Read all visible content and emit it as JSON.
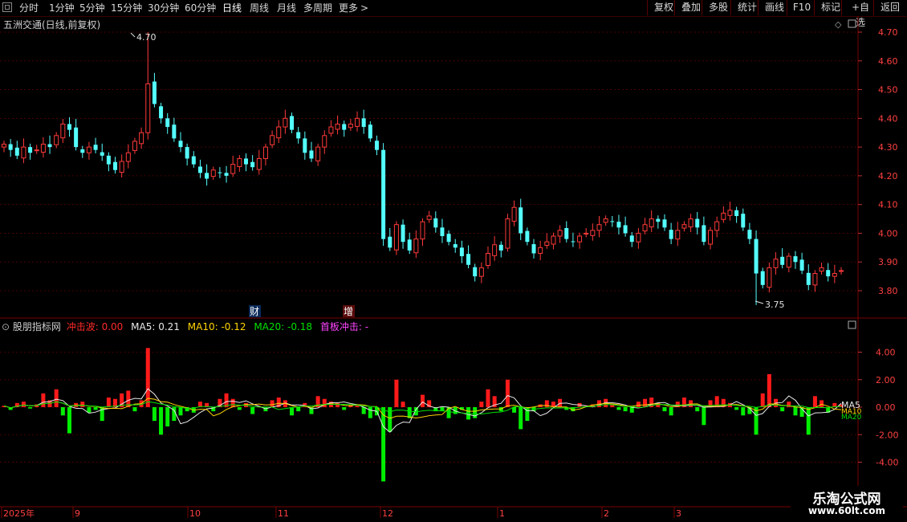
{
  "toolbar": {
    "periods": [
      "分时",
      "1分钟",
      "5分钟",
      "15分钟",
      "30分钟",
      "60分钟",
      "日线",
      "周线",
      "月线",
      "多周期",
      "更多"
    ],
    "active_period": "日线",
    "more_chevron": "chevron-right-icon",
    "buttons": [
      "复权",
      "叠加",
      "多股",
      "统计",
      "画线",
      "F10",
      "标记",
      "+自选",
      "返回"
    ]
  },
  "main_chart": {
    "title": "五洲交通(日线,前复权)",
    "y_ticks": [
      "4.70",
      "4.60",
      "4.50",
      "4.40",
      "4.30",
      "4.20",
      "4.10",
      "4.00",
      "3.90",
      "3.80"
    ],
    "high_label": "4.70",
    "low_label": "3.75",
    "markers": [
      "财",
      "增"
    ]
  },
  "indicator": {
    "name": "股朋指标网",
    "legend": [
      {
        "label": "冲击波: 0.00",
        "color": "#ff2a2a"
      },
      {
        "label": "MA5: 0.21",
        "color": "#e8e8e8"
      },
      {
        "label": "MA10: -0.12",
        "color": "#ffd400"
      },
      {
        "label": "MA20: -0.18",
        "color": "#00e000"
      },
      {
        "label": "首板冲击: -",
        "color": "#ff44ff"
      }
    ],
    "y_ticks": [
      "4.00",
      "2.00",
      "0.00",
      "-2.00",
      "-4.00"
    ],
    "end_labels": [
      "MA5",
      "MA10",
      "MA20"
    ]
  },
  "x_axis": {
    "labels": [
      "2025年",
      "9",
      "10",
      "11",
      "12",
      "1",
      "2",
      "3"
    ]
  },
  "brand": {
    "title": "乐淘公式网",
    "url": "www.60lt.com"
  },
  "colors": {
    "up": "#ff3a3a",
    "down": "#54ffff",
    "grid": "#5a0000",
    "impulse_up": "#ff1a1a",
    "impulse_down": "#00ee00"
  },
  "chart_data": {
    "type": "candlestick",
    "title": "五洲交通(日线,前复权)",
    "ylim": [
      3.7,
      4.75
    ],
    "close_series": [
      4.31,
      4.29,
      4.27,
      4.3,
      4.28,
      4.29,
      4.31,
      4.3,
      4.34,
      4.38,
      4.36,
      4.3,
      4.28,
      4.3,
      4.29,
      4.27,
      4.24,
      4.22,
      4.25,
      4.28,
      4.32,
      4.35,
      4.52,
      4.45,
      4.4,
      4.37,
      4.33,
      4.3,
      4.26,
      4.24,
      4.21,
      4.19,
      4.22,
      4.21,
      4.2,
      4.24,
      4.26,
      4.24,
      4.23,
      4.26,
      4.3,
      4.34,
      4.37,
      4.4,
      4.36,
      4.33,
      4.28,
      4.26,
      4.3,
      4.34,
      4.37,
      4.38,
      4.36,
      4.38,
      4.4,
      4.37,
      4.33,
      4.29,
      3.98,
      3.95,
      4.03,
      3.97,
      3.94,
      3.98,
      4.04,
      4.06,
      4.02,
      3.99,
      3.97,
      3.95,
      3.92,
      3.89,
      3.85,
      3.88,
      3.93,
      3.96,
      3.94,
      4.05,
      4.09,
      4.0,
      3.97,
      3.93,
      3.95,
      3.97,
      3.99,
      4.01,
      3.98,
      3.97,
      3.99,
      4.0,
      4.01,
      4.03,
      4.05,
      4.04,
      4.02,
      4.0,
      3.97,
      4.0,
      4.03,
      4.05,
      4.04,
      4.02,
      3.98,
      4.01,
      4.03,
      4.05,
      4.02,
      3.97,
      4.01,
      4.04,
      4.07,
      4.08,
      4.06,
      4.02,
      3.98,
      3.86,
      3.82,
      3.88,
      3.91,
      3.89,
      3.92,
      3.9,
      3.87,
      3.82,
      3.86,
      3.88,
      3.85,
      3.86,
      3.87
    ],
    "high": 4.7,
    "low": 3.75,
    "indicator_series": [
      {
        "name": "冲击波",
        "values": [
          0.1,
          -0.2,
          0.3,
          0.4,
          -0.1,
          0.2,
          1.0,
          0.5,
          1.3,
          -0.6,
          -1.9,
          0.3,
          0.4,
          -0.4,
          -0.2,
          -1.0,
          0.7,
          0.6,
          1.0,
          1.2,
          -0.3,
          0.5,
          4.3,
          -1.0,
          -2.0,
          -1.4,
          -1.0,
          -0.6,
          -0.3,
          -0.4,
          0.4,
          0.3,
          -0.3,
          0.6,
          1.0,
          0.6,
          -0.2,
          0.3,
          -0.5,
          0.1,
          -0.3,
          0.5,
          0.7,
          0.5,
          -0.6,
          -0.3,
          0.3,
          -0.5,
          0.8,
          0.6,
          0.4,
          0.3,
          -0.2,
          0.2,
          0.2,
          -0.5,
          -0.8,
          -0.6,
          -5.4,
          -1.8,
          2.0,
          0.4,
          -0.8,
          -0.6,
          0.9,
          0.5,
          -0.3,
          -0.3,
          -0.8,
          -0.5,
          -0.2,
          -0.9,
          -0.8,
          0.4,
          1.3,
          0.8,
          -0.3,
          2.0,
          -0.4,
          -1.6,
          -1.0,
          -0.3,
          0.2,
          0.5,
          0.4,
          0.6,
          -0.2,
          -0.3,
          0.3,
          0.1,
          0.2,
          0.5,
          0.6,
          0.2,
          -0.2,
          -0.3,
          -0.4,
          0.4,
          0.6,
          0.7,
          0.3,
          -0.3,
          -0.6,
          0.4,
          0.7,
          0.5,
          -0.3,
          -1.3,
          0.5,
          0.8,
          0.6,
          0.3,
          -0.2,
          -0.6,
          -0.5,
          -2.0,
          1.0,
          2.4,
          0.6,
          -0.3,
          0.4,
          -0.6,
          -0.7,
          -2.0,
          0.8,
          0.5,
          -0.4,
          0.3,
          0.2
        ]
      }
    ],
    "indicator_ylim": [
      -5.5,
      5.0
    ],
    "x_tick_labels": [
      "2025年",
      "9",
      "10",
      "11",
      "12",
      "1",
      "2",
      "3"
    ]
  }
}
